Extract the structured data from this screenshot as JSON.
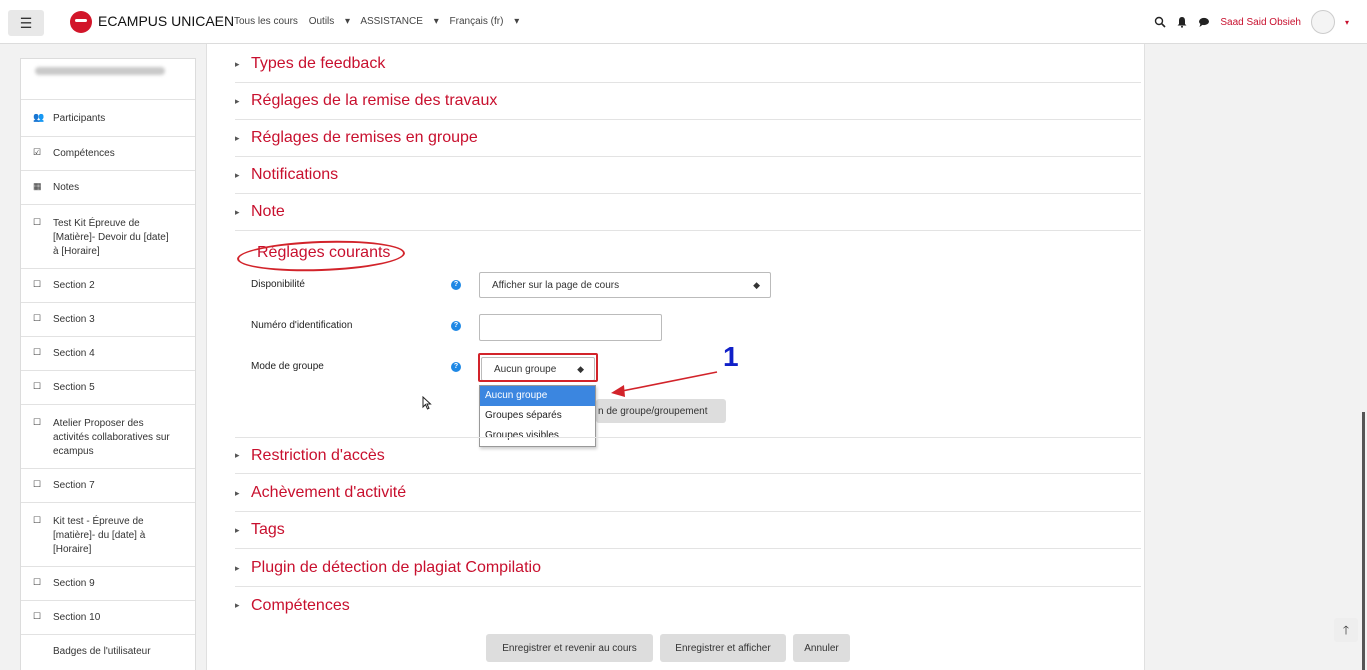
{
  "navbar": {
    "brand": "ECAMPUS UNICAEN",
    "links": [
      "Tous les cours",
      "Outils",
      "ASSISTANCE",
      "Français (fr)"
    ],
    "user": "Saad Said Obsieh"
  },
  "sidebar": {
    "items": [
      {
        "icon": "participants-icon",
        "label": "Participants"
      },
      {
        "icon": "check-square-icon",
        "label": "Compétences"
      },
      {
        "icon": "table-icon",
        "label": "Notes"
      },
      {
        "icon": "folder-icon",
        "label": "Test Kit Épreuve de [Matière]- Devoir du [date] à [Horaire]"
      },
      {
        "icon": "folder-icon",
        "label": "Section 2"
      },
      {
        "icon": "folder-icon",
        "label": "Section 3"
      },
      {
        "icon": "folder-icon",
        "label": "Section 4"
      },
      {
        "icon": "folder-icon",
        "label": "Section 5"
      },
      {
        "icon": "folder-icon",
        "label": "Atelier Proposer des activités collaboratives sur ecampus"
      },
      {
        "icon": "folder-icon",
        "label": "Section 7"
      },
      {
        "icon": "folder-icon",
        "label": "Kit test - Épreuve de [matière]- du [date] à [Horaire]"
      },
      {
        "icon": "folder-icon",
        "label": "Section 9"
      },
      {
        "icon": "folder-icon",
        "label": "Section 10"
      },
      {
        "icon": "",
        "label": "Badges de l'utilisateur"
      }
    ]
  },
  "sections_top": [
    "Types de feedback",
    "Réglages de la remise des travaux",
    "Réglages de remises en groupe",
    "Notifications",
    "Note"
  ],
  "general": {
    "title": "Réglages courants",
    "availability_label": "Disponibilité",
    "availability_value": "Afficher sur la page de cours",
    "idnumber_label": "Numéro d'identification",
    "groupmode_label": "Mode de groupe",
    "groupmode_value": "Aucun groupe",
    "groupmode_options": [
      "Aucun groupe",
      "Groupes séparés",
      "Groupes visibles"
    ],
    "grouping_button_partial": "n de groupe/groupement"
  },
  "annotation": "1",
  "sections_bottom": [
    "Restriction d'accès",
    "Achèvement d'activité",
    "Tags",
    "Plugin de détection de plagiat Compilatio",
    "Compétences"
  ],
  "buttons": {
    "save_return": "Enregistrer et revenir au cours",
    "save_display": "Enregistrer et afficher",
    "cancel": "Annuler"
  },
  "colors": {
    "accent": "#c8102e",
    "annotation_blue": "#1020c8",
    "selection": "#3b86e0"
  }
}
